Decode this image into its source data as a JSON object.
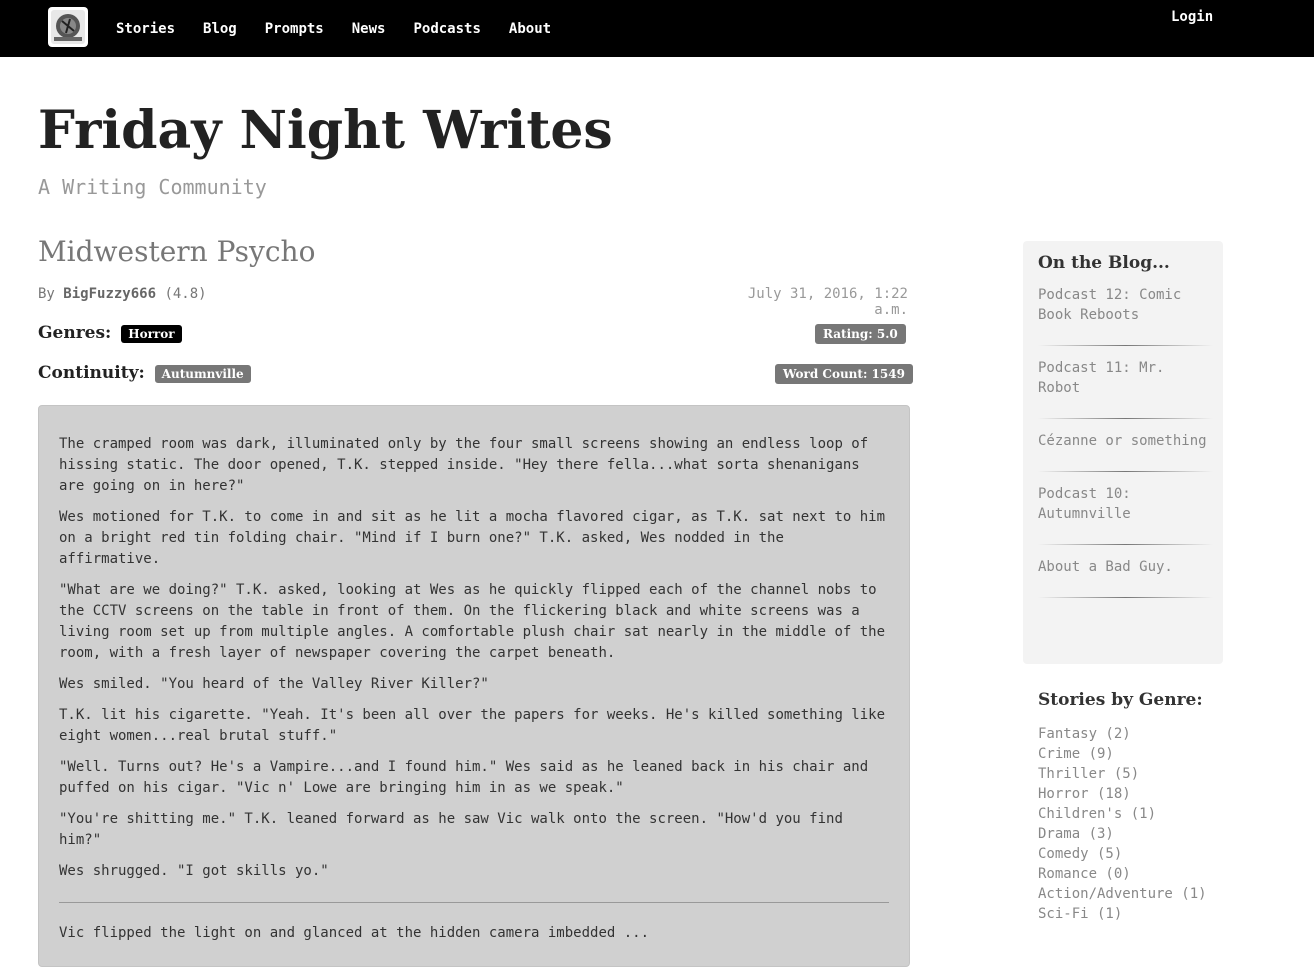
{
  "nav": {
    "links": [
      "Stories",
      "Blog",
      "Prompts",
      "News",
      "Podcasts",
      "About"
    ],
    "login": "Login"
  },
  "site": {
    "title": "Friday Night Writes",
    "subtitle": "A Writing Community"
  },
  "story": {
    "title": "Midwestern Psycho",
    "by_prefix": "By",
    "author": "BigFuzzy666",
    "author_rating": "(4.8)",
    "date": "July 31, 2016, 1:22 a.m.",
    "genres_label": "Genres:",
    "genre": "Horror",
    "continuity_label": "Continuity:",
    "continuity": "Autumnville",
    "rating": "Rating: 5.0",
    "word_count": "Word Count: 1549",
    "paragraphs": [
      "The cramped room was dark, illuminated only by the four small screens showing an endless loop of hissing static. The door opened, T.K. stepped inside. \"Hey there fella...what sorta shenanigans are going on in here?\"",
      "Wes motioned for T.K. to come in and sit as he lit a mocha flavored cigar, as T.K. sat next to him on a bright red tin folding chair. \"Mind if I burn one?\" T.K. asked, Wes nodded in the affirmative.",
      "\"What are we doing?\" T.K. asked, looking at Wes as he quickly flipped each of the channel nobs to the CCTV screens on the table in front of them. On the flickering black and white screens was a living room set up from multiple angles. A comfortable plush chair sat nearly in the middle of the room, with a fresh layer of newspaper covering the carpet beneath.",
      "Wes smiled. \"You heard of the Valley River Killer?\"",
      "T.K. lit his cigarette. \"Yeah. It's been all over the papers for weeks. He's killed something like eight women...real brutal stuff.\"",
      "\"Well. Turns out? He's a Vampire...and I found him.\" Wes said as he leaned back in his chair and puffed on his cigar. \"Vic n' Lowe are bringing him in as we speak.\"",
      "\"You're shitting me.\" T.K. leaned forward as he saw Vic walk onto the screen. \"How'd you find him?\"",
      "Wes shrugged. \"I got skills yo.\""
    ],
    "after_break": "Vic flipped the light on and glanced at the hidden camera imbedded ..."
  },
  "sidebar": {
    "blog_heading": "On the Blog...",
    "blog_items": [
      "Podcast 12: Comic Book Reboots",
      "Podcast 11: Mr. Robot",
      "Cézanne or something",
      "Podcast 10: Autumnville",
      "About a Bad Guy."
    ],
    "genre_heading": "Stories by Genre:",
    "genres": [
      "Fantasy (2)",
      "Crime (9)",
      "Thriller (5)",
      "Horror (18)",
      "Children's (1)",
      "Drama (3)",
      "Comedy (5)",
      "Romance (0)",
      "Action/Adventure (1)",
      "Sci-Fi (1)"
    ]
  }
}
